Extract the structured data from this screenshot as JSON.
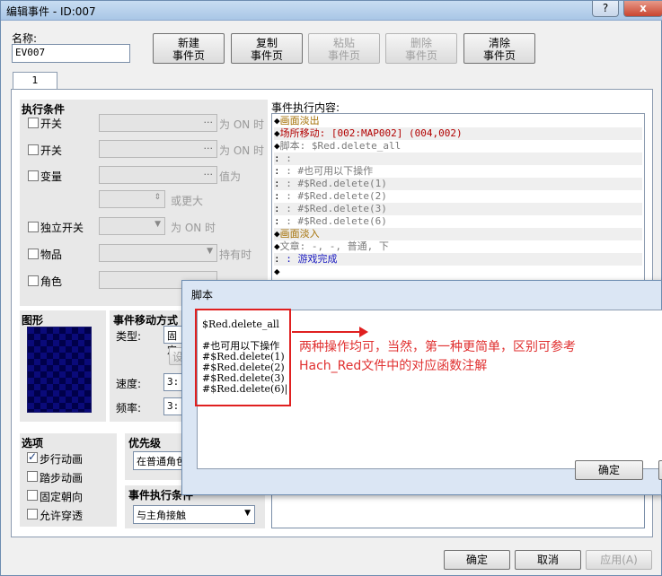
{
  "window": {
    "title": "编辑事件 - ID:007",
    "help": "?",
    "close": "x"
  },
  "name": {
    "label": "名称:",
    "value": "EV007"
  },
  "toolbar": {
    "new": "新建\n事件页",
    "copy": "复制\n事件页",
    "paste": "粘贴\n事件页",
    "delete": "删除\n事件页",
    "clear": "清除\n事件页"
  },
  "tab": "1",
  "conditions": {
    "title": "执行条件",
    "switch1": "开关",
    "switch1_suffix": "为 ON 时",
    "switch2": "开关",
    "switch2_suffix": "为 ON 时",
    "variable": "变量",
    "variable_suffix": "值为",
    "variable_more": "或更大",
    "selfswitch": "独立开关",
    "selfswitch_suffix": "为 ON 时",
    "item": "物品",
    "item_suffix": "持有时",
    "actor": "角色"
  },
  "commands": {
    "label": "事件执行内容:",
    "lines": [
      {
        "prefix": "◆",
        "text": "画面淡出",
        "color": "gold"
      },
      {
        "prefix": "◆",
        "text": "场所移动: [002:MAP002] (004,002)",
        "color": "red"
      },
      {
        "prefix": "◆",
        "text": "脚本: $Red.delete_all",
        "color": "gray"
      },
      {
        "prefix": ":",
        "text": "       :",
        "color": "gray"
      },
      {
        "prefix": ":",
        "text": "       :   #也可用以下操作",
        "color": "gray"
      },
      {
        "prefix": ":",
        "text": "       :   #$Red.delete(1)",
        "color": "gray"
      },
      {
        "prefix": ":",
        "text": "       :   #$Red.delete(2)",
        "color": "gray"
      },
      {
        "prefix": ":",
        "text": "       :   #$Red.delete(3)",
        "color": "gray"
      },
      {
        "prefix": ":",
        "text": "       :   #$Red.delete(6)",
        "color": "gray"
      },
      {
        "prefix": "◆",
        "text": "画面淡入",
        "color": "gold"
      },
      {
        "prefix": "◆",
        "text": "文章: -, -, 普通, 下",
        "color": "gray"
      },
      {
        "prefix": ":",
        "text": "       :   游戏完成",
        "color": "blue"
      },
      {
        "prefix": "◆",
        "text": "",
        "color": "gray"
      }
    ]
  },
  "graphic": {
    "title": "图形"
  },
  "movement": {
    "title": "事件移动方式",
    "type_label": "类型:",
    "type_value": "固定",
    "set_btn": "设",
    "speed_label": "速度:",
    "speed_value": "3:",
    "freq_label": "频率:",
    "freq_value": "3:"
  },
  "options": {
    "title": "选项",
    "walk_anim": "步行动画",
    "walk_anim_checked": true,
    "step_anim": "踏步动画",
    "fixed_dir": "固定朝向",
    "through": "允许穿透"
  },
  "priority": {
    "title": "优先级",
    "value": "在普通角色"
  },
  "trigger": {
    "title": "事件执行条件",
    "value": "与主角接触"
  },
  "dialog": {
    "title": "脚本",
    "script": "$Red.delete_all\n\n#也可用以下操作\n#$Red.delete(1)\n#$Red.delete(2)\n#$Red.delete(3)\n#$Red.delete(6)|",
    "note1": "两种操作均可，当然，第一种更简单，区别可参考",
    "note2": "Hach_Red文件中的对应函数注解",
    "ok": "确定"
  },
  "footer": {
    "ok": "确定",
    "cancel": "取消",
    "apply": "应用(A)"
  }
}
